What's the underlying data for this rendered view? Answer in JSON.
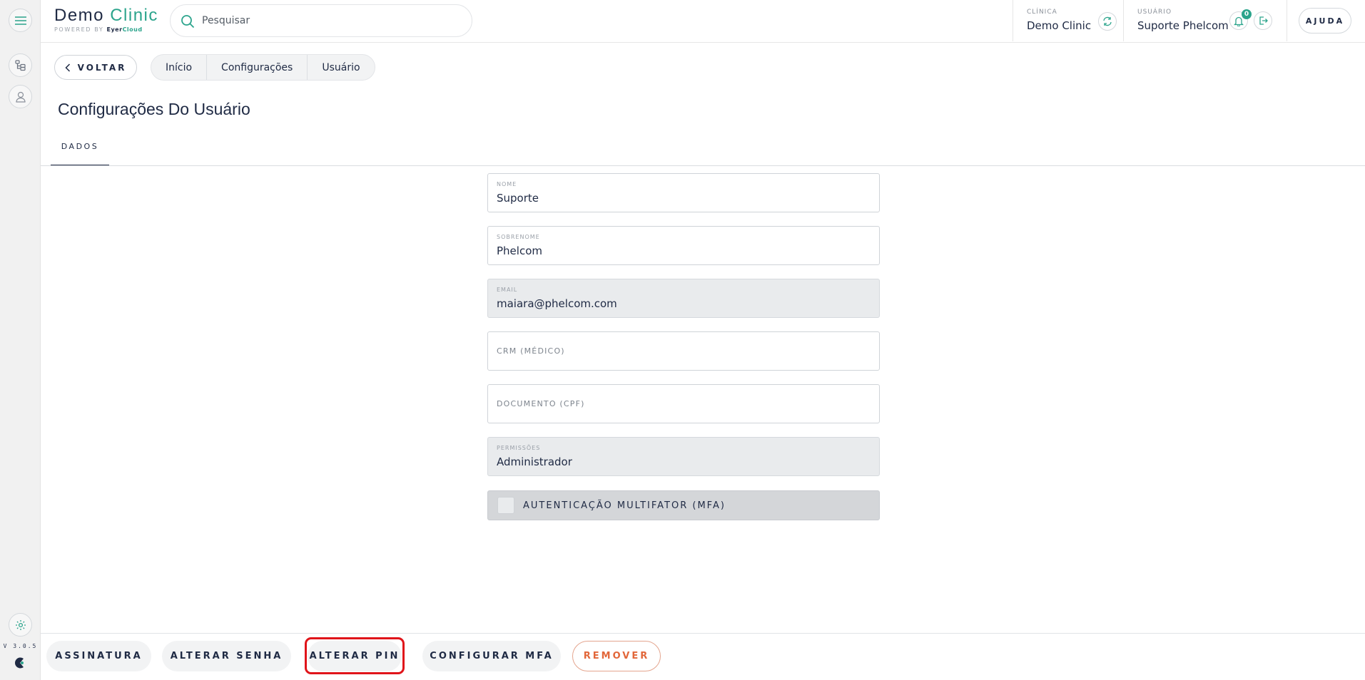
{
  "brand": {
    "name_part1": "Demo",
    "name_part2": "Clinic",
    "powered_by": "POWERED BY",
    "cloud_part1": "Eyer",
    "cloud_part2": "Cloud"
  },
  "search": {
    "placeholder": "Pesquisar"
  },
  "header": {
    "clinic_label": "CLÍNICA",
    "clinic_value": "Demo Clinic",
    "user_label": "USUÁRIO",
    "user_value": "Suporte Phelcom",
    "notifications_count": "0",
    "help_label": "AJUDA"
  },
  "nav": {
    "back_label": "VOLTAR",
    "breadcrumbs": [
      "Início",
      "Configurações",
      "Usuário"
    ]
  },
  "page": {
    "title": "Configurações Do Usuário",
    "tab": "DADOS"
  },
  "form": {
    "nome": {
      "label": "NOME",
      "value": "Suporte"
    },
    "sobrenome": {
      "label": "SOBRENOME",
      "value": "Phelcom"
    },
    "email": {
      "label": "EMAIL",
      "value": "maiara@phelcom.com"
    },
    "crm": {
      "placeholder": "CRM (MÉDICO)"
    },
    "documento": {
      "placeholder": "DOCUMENTO (CPF)"
    },
    "permissoes": {
      "label": "PERMISSÕES",
      "value": "Administrador"
    },
    "mfa": {
      "label": "AUTENTICAÇÃO MULTIFATOR (MFA)",
      "checked": false
    }
  },
  "actions": {
    "assinatura": "ASSINATURA",
    "alterar_senha": "ALTERAR SENHA",
    "alterar_pin": "ALTERAR PIN",
    "configurar_mfa": "CONFIGURAR MFA",
    "remover": "REMOVER"
  },
  "sidebar": {
    "version": "V 3.0.5"
  },
  "colors": {
    "accent": "#2ba48c",
    "text": "#1f2a44",
    "danger": "#e2673a",
    "highlight": "#e0141a"
  }
}
